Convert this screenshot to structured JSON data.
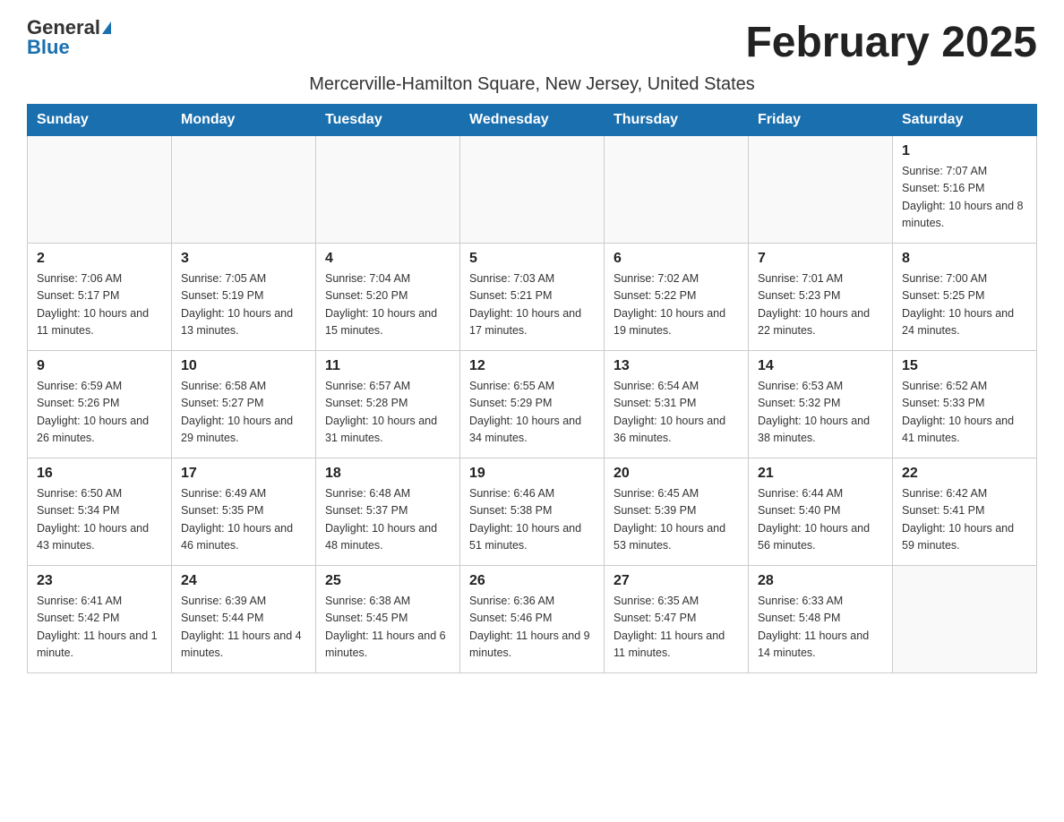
{
  "logo": {
    "general": "General",
    "blue": "Blue"
  },
  "header": {
    "month_year": "February 2025",
    "location": "Mercerville-Hamilton Square, New Jersey, United States"
  },
  "weekdays": [
    "Sunday",
    "Monday",
    "Tuesday",
    "Wednesday",
    "Thursday",
    "Friday",
    "Saturday"
  ],
  "weeks": [
    [
      {
        "day": "",
        "info": ""
      },
      {
        "day": "",
        "info": ""
      },
      {
        "day": "",
        "info": ""
      },
      {
        "day": "",
        "info": ""
      },
      {
        "day": "",
        "info": ""
      },
      {
        "day": "",
        "info": ""
      },
      {
        "day": "1",
        "info": "Sunrise: 7:07 AM\nSunset: 5:16 PM\nDaylight: 10 hours and 8 minutes."
      }
    ],
    [
      {
        "day": "2",
        "info": "Sunrise: 7:06 AM\nSunset: 5:17 PM\nDaylight: 10 hours and 11 minutes."
      },
      {
        "day": "3",
        "info": "Sunrise: 7:05 AM\nSunset: 5:19 PM\nDaylight: 10 hours and 13 minutes."
      },
      {
        "day": "4",
        "info": "Sunrise: 7:04 AM\nSunset: 5:20 PM\nDaylight: 10 hours and 15 minutes."
      },
      {
        "day": "5",
        "info": "Sunrise: 7:03 AM\nSunset: 5:21 PM\nDaylight: 10 hours and 17 minutes."
      },
      {
        "day": "6",
        "info": "Sunrise: 7:02 AM\nSunset: 5:22 PM\nDaylight: 10 hours and 19 minutes."
      },
      {
        "day": "7",
        "info": "Sunrise: 7:01 AM\nSunset: 5:23 PM\nDaylight: 10 hours and 22 minutes."
      },
      {
        "day": "8",
        "info": "Sunrise: 7:00 AM\nSunset: 5:25 PM\nDaylight: 10 hours and 24 minutes."
      }
    ],
    [
      {
        "day": "9",
        "info": "Sunrise: 6:59 AM\nSunset: 5:26 PM\nDaylight: 10 hours and 26 minutes."
      },
      {
        "day": "10",
        "info": "Sunrise: 6:58 AM\nSunset: 5:27 PM\nDaylight: 10 hours and 29 minutes."
      },
      {
        "day": "11",
        "info": "Sunrise: 6:57 AM\nSunset: 5:28 PM\nDaylight: 10 hours and 31 minutes."
      },
      {
        "day": "12",
        "info": "Sunrise: 6:55 AM\nSunset: 5:29 PM\nDaylight: 10 hours and 34 minutes."
      },
      {
        "day": "13",
        "info": "Sunrise: 6:54 AM\nSunset: 5:31 PM\nDaylight: 10 hours and 36 minutes."
      },
      {
        "day": "14",
        "info": "Sunrise: 6:53 AM\nSunset: 5:32 PM\nDaylight: 10 hours and 38 minutes."
      },
      {
        "day": "15",
        "info": "Sunrise: 6:52 AM\nSunset: 5:33 PM\nDaylight: 10 hours and 41 minutes."
      }
    ],
    [
      {
        "day": "16",
        "info": "Sunrise: 6:50 AM\nSunset: 5:34 PM\nDaylight: 10 hours and 43 minutes."
      },
      {
        "day": "17",
        "info": "Sunrise: 6:49 AM\nSunset: 5:35 PM\nDaylight: 10 hours and 46 minutes."
      },
      {
        "day": "18",
        "info": "Sunrise: 6:48 AM\nSunset: 5:37 PM\nDaylight: 10 hours and 48 minutes."
      },
      {
        "day": "19",
        "info": "Sunrise: 6:46 AM\nSunset: 5:38 PM\nDaylight: 10 hours and 51 minutes."
      },
      {
        "day": "20",
        "info": "Sunrise: 6:45 AM\nSunset: 5:39 PM\nDaylight: 10 hours and 53 minutes."
      },
      {
        "day": "21",
        "info": "Sunrise: 6:44 AM\nSunset: 5:40 PM\nDaylight: 10 hours and 56 minutes."
      },
      {
        "day": "22",
        "info": "Sunrise: 6:42 AM\nSunset: 5:41 PM\nDaylight: 10 hours and 59 minutes."
      }
    ],
    [
      {
        "day": "23",
        "info": "Sunrise: 6:41 AM\nSunset: 5:42 PM\nDaylight: 11 hours and 1 minute."
      },
      {
        "day": "24",
        "info": "Sunrise: 6:39 AM\nSunset: 5:44 PM\nDaylight: 11 hours and 4 minutes."
      },
      {
        "day": "25",
        "info": "Sunrise: 6:38 AM\nSunset: 5:45 PM\nDaylight: 11 hours and 6 minutes."
      },
      {
        "day": "26",
        "info": "Sunrise: 6:36 AM\nSunset: 5:46 PM\nDaylight: 11 hours and 9 minutes."
      },
      {
        "day": "27",
        "info": "Sunrise: 6:35 AM\nSunset: 5:47 PM\nDaylight: 11 hours and 11 minutes."
      },
      {
        "day": "28",
        "info": "Sunrise: 6:33 AM\nSunset: 5:48 PM\nDaylight: 11 hours and 14 minutes."
      },
      {
        "day": "",
        "info": ""
      }
    ]
  ]
}
